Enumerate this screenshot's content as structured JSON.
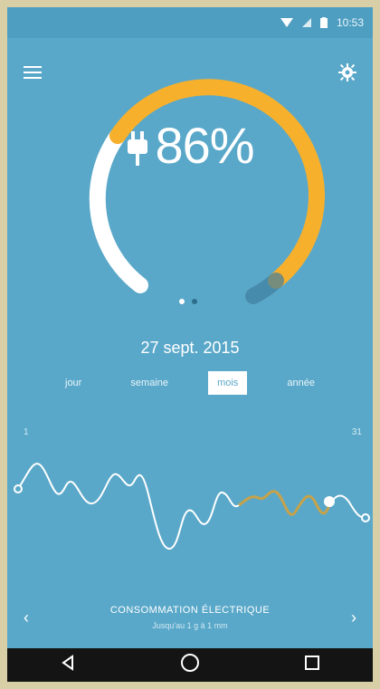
{
  "status_bar": {
    "time": "10:53"
  },
  "main": {
    "percentage": "86%",
    "date": "27 sept. 2015",
    "tabs": [
      "jour",
      "semaine",
      "mois",
      "année"
    ],
    "active_tab_index": 2,
    "axis_left": "1",
    "axis_right": "31"
  },
  "footer": {
    "title": "CONSOMMATION ÉLECTRIQUE",
    "subtitle": "Jusqu'au 1 g à 1 mm"
  },
  "colors": {
    "background": "#5aa8c9",
    "accent": "#f7b02c",
    "white": "#ffffff"
  },
  "icons": {
    "menu": "hamburger-menu-icon",
    "settings": "gear-icon",
    "plug": "plug-icon",
    "prev": "chevron-left-icon",
    "next": "chevron-right-icon",
    "back": "back-triangle-icon",
    "home": "home-circle-icon",
    "recents": "recents-square-icon"
  }
}
